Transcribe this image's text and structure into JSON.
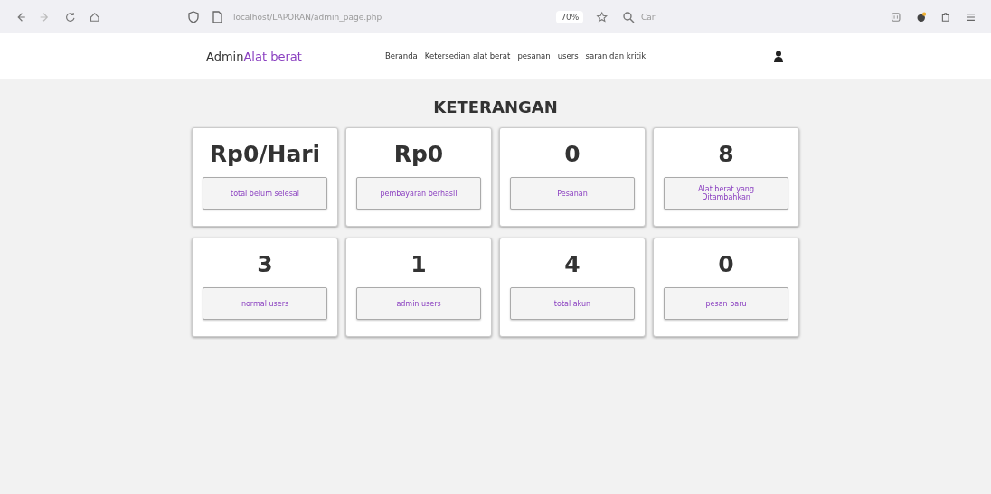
{
  "browser": {
    "url": "localhost/LAPORAN/admin_page.php",
    "zoom": "70%",
    "search_placeholder": "Cari"
  },
  "navbar": {
    "brand": "Admin",
    "brand_accent": "Alat berat",
    "links": [
      "Beranda",
      "Ketersedian alat berat",
      "pesanan",
      "users",
      "saran dan kritik"
    ]
  },
  "heading": "KETERANGAN",
  "cards": [
    {
      "value": "Rp0/Hari",
      "label": "total belum selesai"
    },
    {
      "value": "Rp0",
      "label": "pembayaran berhasil"
    },
    {
      "value": "0",
      "label": "Pesanan"
    },
    {
      "value": "8",
      "label": "Alat berat yang Ditambahkan"
    },
    {
      "value": "3",
      "label": "normal users"
    },
    {
      "value": "1",
      "label": "admin users"
    },
    {
      "value": "4",
      "label": "total akun"
    },
    {
      "value": "0",
      "label": "pesan baru"
    }
  ]
}
